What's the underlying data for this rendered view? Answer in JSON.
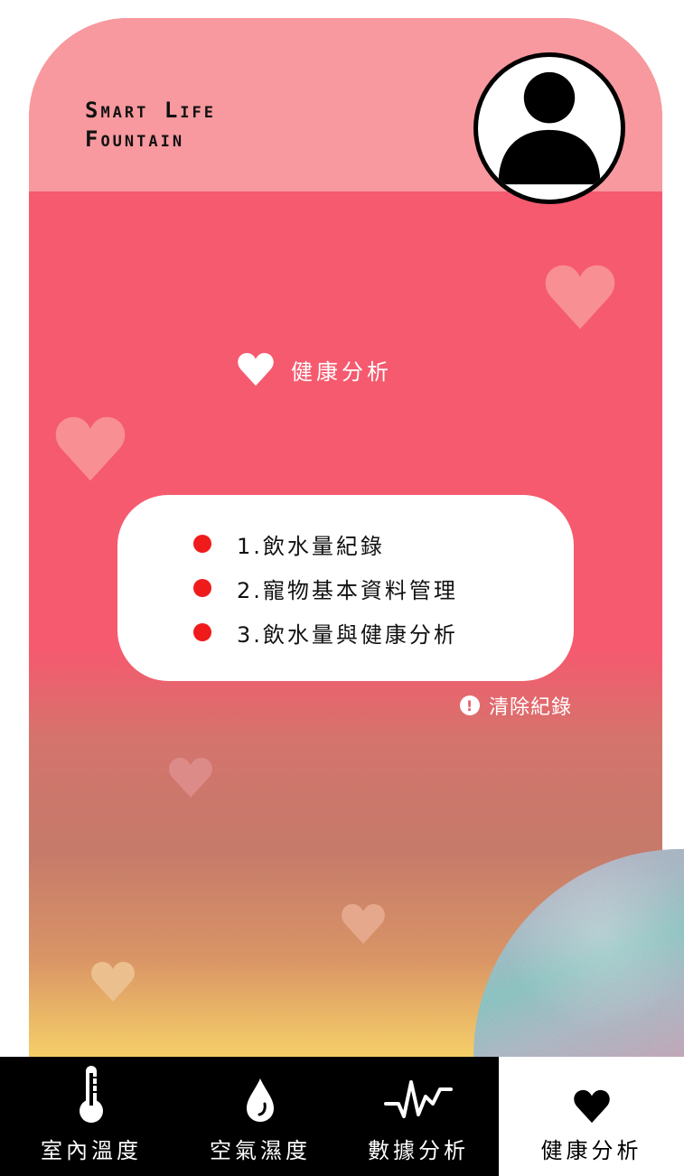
{
  "app": {
    "brand_line1": "Smart Life",
    "brand_line2": "Fountain"
  },
  "colors": {
    "primary": "#f55a6f",
    "header": "#f7999e",
    "bullet": "#ef1b1b",
    "tabbar": "#000000",
    "active_tab": "#ffffff"
  },
  "profile": {
    "icon": "user-avatar-icon"
  },
  "section": {
    "icon": "heart-icon",
    "title": "健康分析"
  },
  "menu": {
    "items": [
      {
        "label": "1.飲水量紀錄"
      },
      {
        "label": "2.寵物基本資料管理"
      },
      {
        "label": "3.飲水量與健康分析"
      }
    ]
  },
  "clear_action": {
    "icon": "alert-icon",
    "label": "清除紀錄"
  },
  "tabbar": {
    "tabs": [
      {
        "label": "室內溫度",
        "icon": "thermometer-icon",
        "active": false
      },
      {
        "label": "空氣濕度",
        "icon": "water-drop-icon",
        "active": false
      },
      {
        "label": "數據分析",
        "icon": "pulse-line-icon",
        "active": false
      },
      {
        "label": "健康分析",
        "icon": "heart-icon",
        "active": true
      }
    ]
  }
}
